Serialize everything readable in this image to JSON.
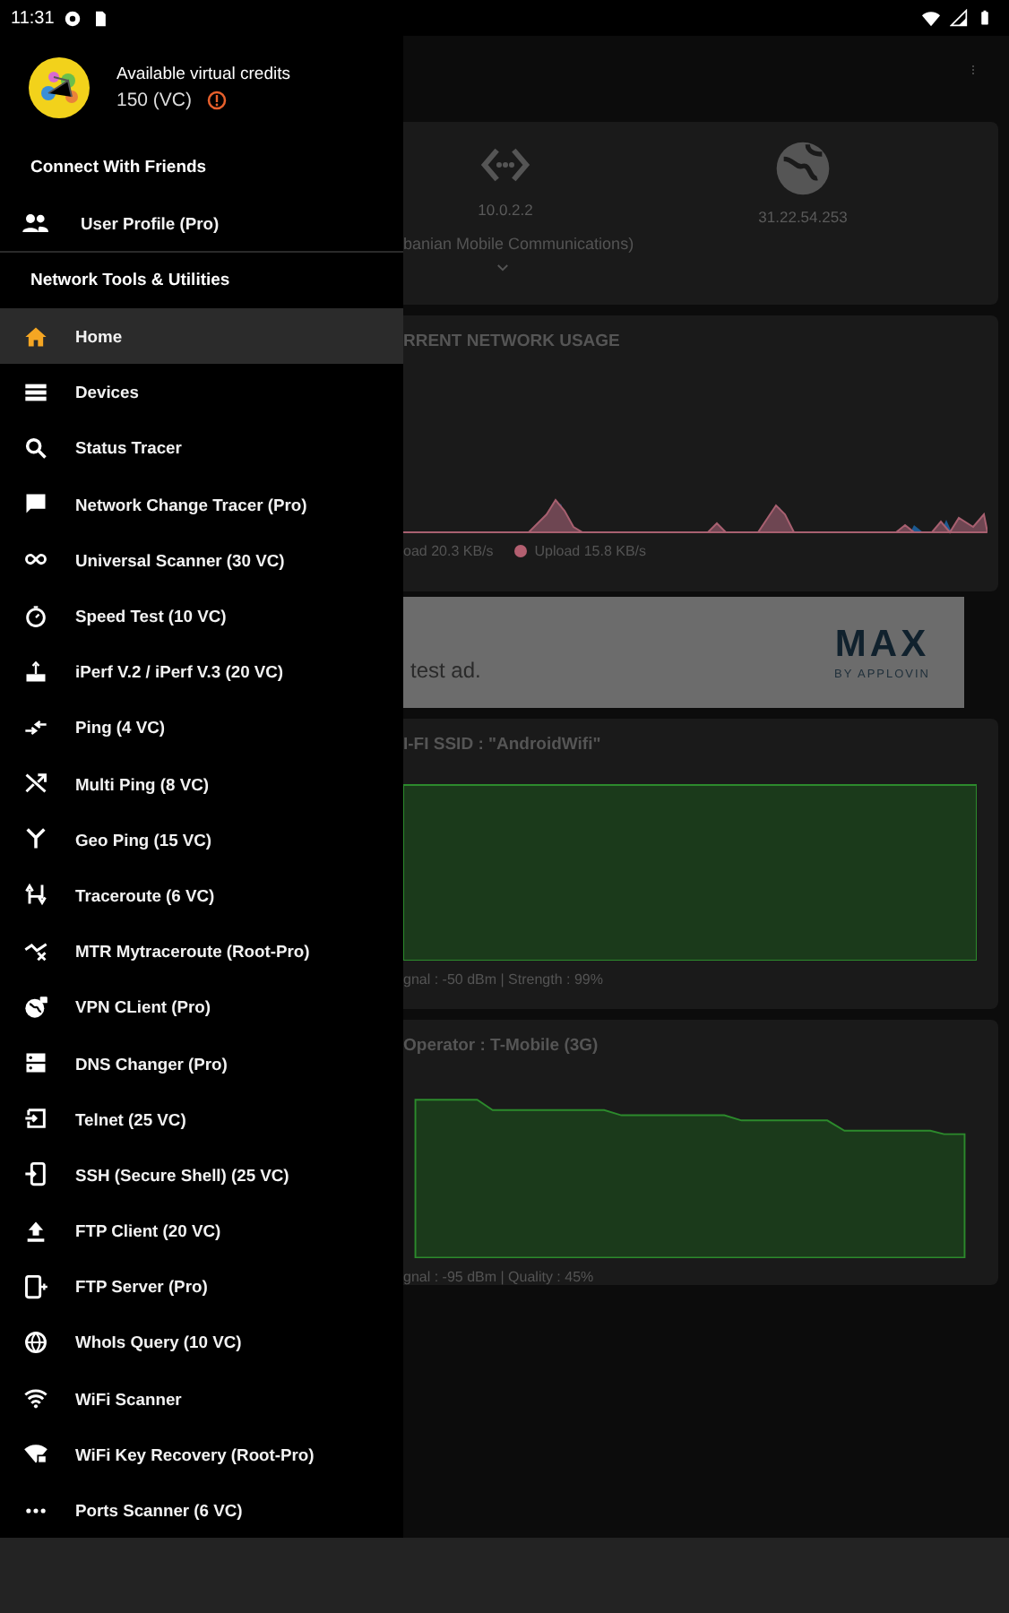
{
  "status_bar": {
    "time": "11:31"
  },
  "drawer": {
    "credits_label": "Available virtual credits",
    "credits_value": "150 (VC)",
    "friends_section": "Connect With Friends",
    "friends_items": [
      {
        "label": "User Profile (Pro)",
        "selected": false
      }
    ],
    "tools_section": "Network Tools & Utilities",
    "items": [
      {
        "label": "Home",
        "selected": true
      },
      {
        "label": "Devices",
        "selected": false
      },
      {
        "label": "Status Tracer",
        "selected": false
      },
      {
        "label": "Network Change Tracer (Pro)",
        "selected": false
      },
      {
        "label": "Universal Scanner (30 VC)",
        "selected": false
      },
      {
        "label": "Speed Test (10 VC)",
        "selected": false
      },
      {
        "label": "iPerf V.2 / iPerf V.3 (20 VC)",
        "selected": false
      },
      {
        "label": "Ping (4 VC)",
        "selected": false
      },
      {
        "label": "Multi Ping (8 VC)",
        "selected": false
      },
      {
        "label": "Geo Ping (15 VC)",
        "selected": false
      },
      {
        "label": "Traceroute (6 VC)",
        "selected": false
      },
      {
        "label": "MTR Mytraceroute (Root-Pro)",
        "selected": false
      },
      {
        "label": "VPN CLient (Pro)",
        "selected": false
      },
      {
        "label": "DNS Changer (Pro)",
        "selected": false
      },
      {
        "label": "Telnet (25 VC)",
        "selected": false
      },
      {
        "label": "SSH (Secure Shell) (25 VC)",
        "selected": false
      },
      {
        "label": "FTP Client (20 VC)",
        "selected": false
      },
      {
        "label": "FTP Server (Pro)",
        "selected": false
      },
      {
        "label": "WhoIs Query (10 VC)",
        "selected": false
      },
      {
        "label": "WiFi Scanner",
        "selected": false
      },
      {
        "label": "WiFi Key Recovery (Root-Pro)",
        "selected": false
      },
      {
        "label": "Ports Scanner (6 VC)",
        "selected": false
      }
    ]
  },
  "ip_card": {
    "local_ip": "10.0.2.2",
    "public_ip": "31.22.54.253",
    "carrier": "banian Mobile Communications)"
  },
  "usage_card": {
    "title": "RRENT NETWORK USAGE",
    "legend": [
      {
        "label": "oad 20.3  KB/s"
      },
      {
        "label": "Upload 15.8  KB/s",
        "color": "#b35f70"
      }
    ]
  },
  "ad": {
    "text": "test ad.",
    "brand": "MAX",
    "byline": "BY APPLOVIN"
  },
  "wifi_card": {
    "title": "I-FI SSID : \"AndroidWifi\"",
    "footer": "gnal : -50 dBm  |  Strength : 99%"
  },
  "cell_card": {
    "title": "Operator : T-Mobile (3G)",
    "footer": "gnal : -95 dBm  |  Quality : 45%"
  }
}
